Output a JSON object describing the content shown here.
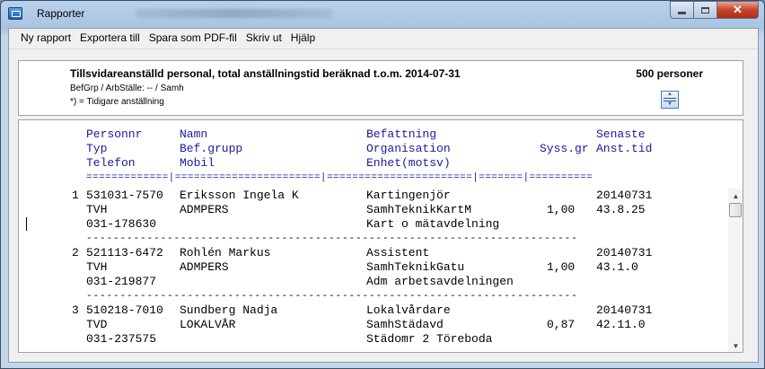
{
  "window": {
    "title": "Rapporter",
    "icon": "report-app-icon",
    "close_glyph": "✕"
  },
  "menu": {
    "items": [
      "Ny rapport",
      "Exportera till",
      "Spara som PDF-fil",
      "Skriv ut",
      "Hjälp"
    ]
  },
  "report_header": {
    "title": "Tillsvidareanställd personal, total anställningstid beräknad t.o.m. 2014-07-31",
    "count": "500 personer",
    "subtitle": "BefGrp / ArbStälle:  --  / Samh",
    "note": "*) = Tidigare anställning"
  },
  "columns": {
    "row1": {
      "c1": "Personnr",
      "c2": "Namn",
      "c3": "Befattning",
      "c4": "",
      "c5": "Senaste"
    },
    "row2": {
      "c1": "Typ",
      "c2": "Bef.grupp",
      "c3": "Organisation",
      "c4": "Syss.gr",
      "c5": "Anst.tid"
    },
    "row3": {
      "c1": "Telefon",
      "c2": "Mobil",
      "c3": "Enhet(motsv)",
      "c4": "",
      "c5": ""
    }
  },
  "separator_line": "=============|=======================|=======================|=======|==========",
  "dash_line": "-------------------------------------------------------------------------",
  "records": [
    {
      "nr": "1",
      "personnr": "531031-7570",
      "namn": "Eriksson Ingela K",
      "befattning": "Kartingenjör",
      "senaste": "20140731",
      "typ": "TVH",
      "befgrupp": "ADMPERS",
      "organisation": "SamhTeknikKartM",
      "syssgr": "1,00",
      "ansttid": "43.8.25",
      "telefon": "031-178630",
      "mobil": "",
      "enhet": "Kart o mätavdelning"
    },
    {
      "nr": "2",
      "personnr": "521113-6472",
      "namn": "Rohlén Markus",
      "befattning": "Assistent",
      "senaste": "20140731",
      "typ": "TVH",
      "befgrupp": "ADMPERS",
      "organisation": "SamhTeknikGatu",
      "syssgr": "1,00",
      "ansttid": "43.1.0",
      "telefon": "031-219877",
      "mobil": "",
      "enhet": "Adm arbetsavdelningen"
    },
    {
      "nr": "3",
      "personnr": "510218-7010",
      "namn": "Sundberg Nadja",
      "befattning": "Lokalvårdare",
      "senaste": "20140731",
      "typ": "TVD",
      "befgrupp": "LOKALVÅR",
      "organisation": "SamhStädavd",
      "syssgr": "0,87",
      "ansttid": "42.11.0",
      "telefon": "031-237575",
      "mobil": "",
      "enhet": "Städomr 2 Töreboda"
    }
  ],
  "scrollbar": {
    "up": "▲",
    "down": "▼"
  }
}
